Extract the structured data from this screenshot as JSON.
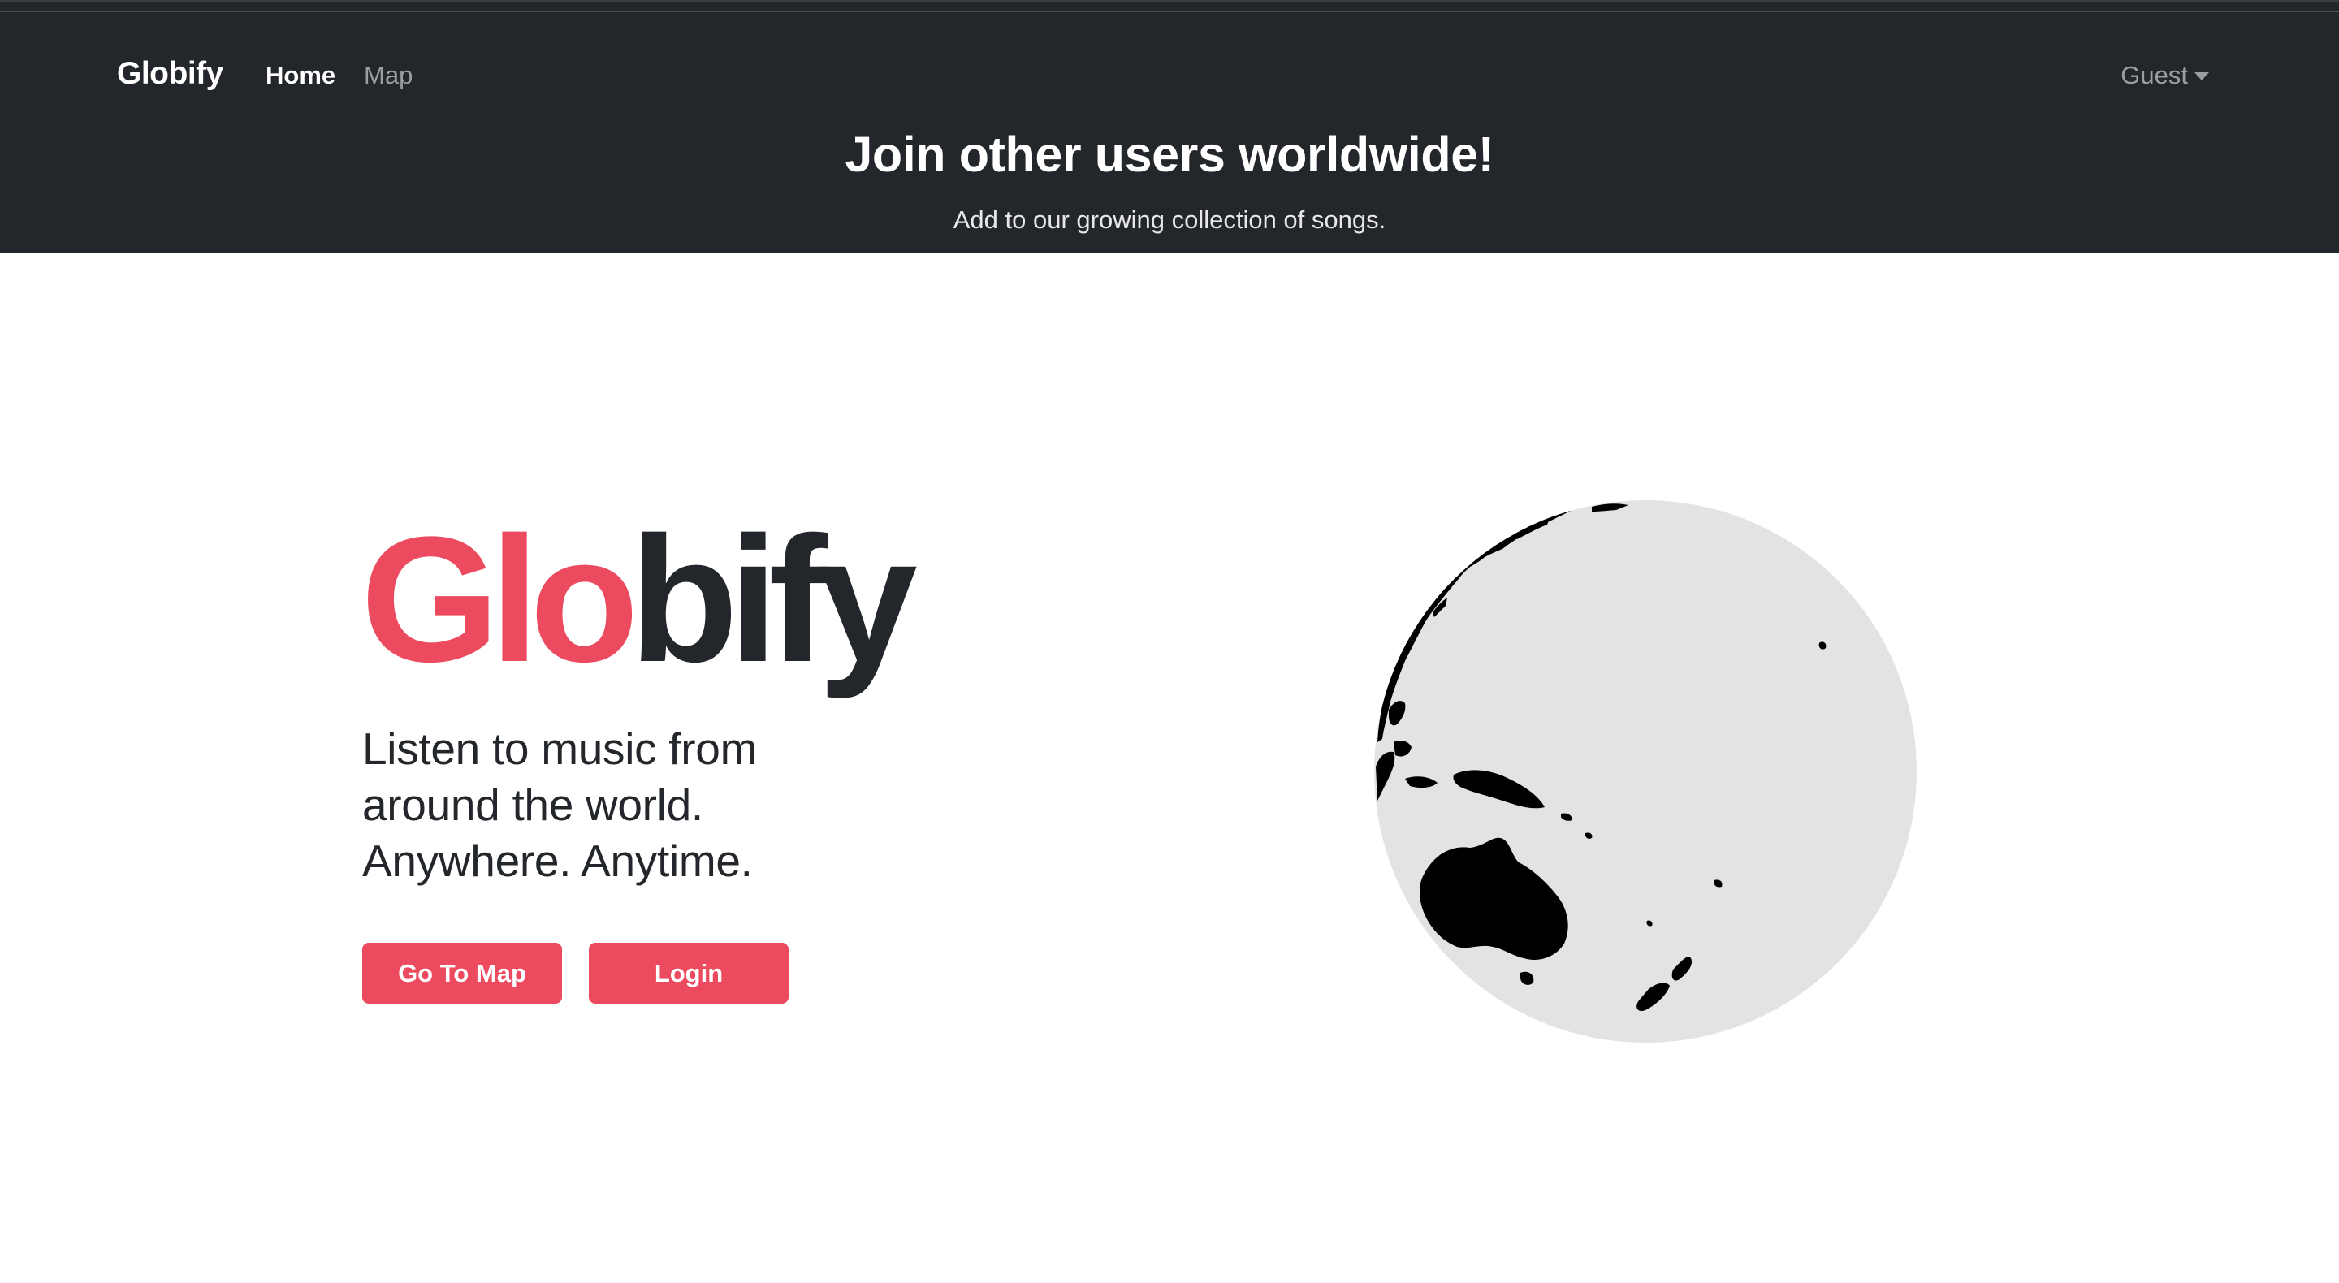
{
  "navbar": {
    "brand": "Globify",
    "links": [
      {
        "label": "Home",
        "active": true
      },
      {
        "label": "Map",
        "active": false
      }
    ],
    "user_menu": {
      "label": "Guest"
    }
  },
  "header": {
    "title": "Join other users worldwide!",
    "subtitle": "Add to our growing collection of songs."
  },
  "hero": {
    "logo_part_accent": "Glo",
    "logo_part_dark": "bify",
    "tagline": [
      "Listen to music from",
      "around the world.",
      "Anywhere. Anytime."
    ],
    "buttons": {
      "go_to_map": "Go To Map",
      "login": "Login"
    }
  },
  "colors": {
    "header_bg": "#23262b",
    "accent": "#ec4b5f",
    "text_dark": "#23262b",
    "globe_ocean": "#e3e3e3",
    "globe_land": "#000000"
  }
}
